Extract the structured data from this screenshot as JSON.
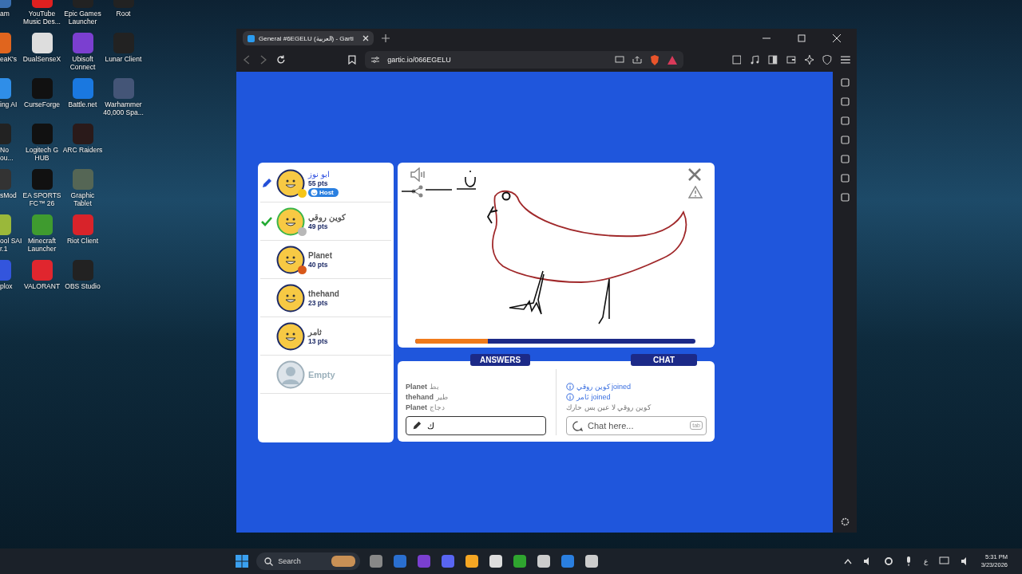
{
  "desktop_icons": [
    {
      "label": "am",
      "color": "#3a6fb0"
    },
    {
      "label": "eaK's",
      "color": "#e0651e"
    },
    {
      "label": "ing AI",
      "color": "#2f8ee8"
    },
    {
      "label": "No\nou...",
      "color": "#222222"
    },
    {
      "label": "sMod",
      "color": "#333333"
    },
    {
      "label": "ool SAI\nr.1",
      "color": "#9ab83a"
    },
    {
      "label": "plox",
      "color": "#3355dd"
    },
    {
      "label": "YouTube\nMusic Des...",
      "color": "#e02020"
    },
    {
      "label": "DualSenseX",
      "color": "#dddddd"
    },
    {
      "label": "CurseForge",
      "color": "#111111"
    },
    {
      "label": "Logitech G\nHUB",
      "color": "#111111"
    },
    {
      "label": "EA SPORTS\nFC™ 26",
      "color": "#111111"
    },
    {
      "label": "Minecraft\nLauncher",
      "color": "#3f9b2f"
    },
    {
      "label": "VALORANT",
      "color": "#e0262e"
    },
    {
      "label": "Epic Games\nLauncher",
      "color": "#222222"
    },
    {
      "label": "Ubisoft\nConnect",
      "color": "#7b3fd0"
    },
    {
      "label": "Battle.net",
      "color": "#1a78e0"
    },
    {
      "label": "ARC Raiders",
      "color": "#2a1a1a"
    },
    {
      "label": "Graphic\nTablet",
      "color": "#556655"
    },
    {
      "label": "Riot Client",
      "color": "#d8232a"
    },
    {
      "label": "OBS Studio",
      "color": "#222222"
    },
    {
      "label": "Root",
      "color": "#222222"
    },
    {
      "label": "Lunar Client",
      "color": "#222222"
    },
    {
      "label": "Warhammer\n40,000 Spa...",
      "color": "#445577"
    }
  ],
  "browser": {
    "tab_title": "General #6EGELU (العربية) - Garti",
    "url": "gartic.io/066EGELU"
  },
  "players": [
    {
      "kind": "player",
      "name": "ابو نوز",
      "points": "55 pts",
      "drawing": true,
      "guessed": false,
      "badge": "Host",
      "color": "#f5c518"
    },
    {
      "kind": "player",
      "name": "كوين روقي",
      "points": "49 pts",
      "drawing": false,
      "guessed": true,
      "color": "#b8b8b8"
    },
    {
      "kind": "player",
      "name": "Planet",
      "points": "40 pts",
      "drawing": false,
      "guessed": false,
      "color": "#d8581a"
    },
    {
      "kind": "player",
      "name": "thehand",
      "points": "23 pts",
      "drawing": false,
      "guessed": false
    },
    {
      "kind": "player",
      "name": "ثامر",
      "points": "13 pts",
      "drawing": false,
      "guessed": false
    },
    {
      "kind": "empty",
      "name": "Empty"
    }
  ],
  "timer": {
    "level": 0.26
  },
  "answers": {
    "tab": "ANSWERS",
    "items": [
      {
        "player": "Planet",
        "guess": "بط"
      },
      {
        "player": "thehand",
        "guess": "طير"
      },
      {
        "player": "Planet",
        "guess": "دجاج"
      }
    ],
    "value": "ك"
  },
  "chat": {
    "tab": "CHAT",
    "messages": [
      {
        "kind": "info",
        "text": "كوين روقي joined"
      },
      {
        "kind": "info",
        "text": "ثامر joined"
      },
      {
        "kind": "message",
        "text": "كوين روقي لا عين بس حارك"
      }
    ],
    "placeholder": "Chat here...",
    "key_hint": "tab"
  },
  "taskbar": {
    "search": "Search",
    "time": "5:31 PM",
    "date": "3/23/2026",
    "language": "ع"
  }
}
